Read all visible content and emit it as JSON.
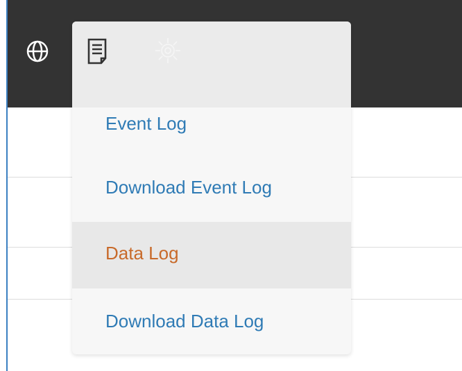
{
  "toolbar": {
    "icons": [
      "globe-icon",
      "log-icon",
      "gear-icon"
    ]
  },
  "menu": {
    "items": [
      {
        "label": "Event Log"
      },
      {
        "label": "Download Event Log"
      },
      {
        "label": "Data Log"
      },
      {
        "label": "Download Data Log"
      }
    ],
    "active_index": 2
  },
  "colors": {
    "topbar": "#333333",
    "link": "#2f7bb5",
    "active": "#c86a2a",
    "accent_border": "#3a7fc1"
  }
}
